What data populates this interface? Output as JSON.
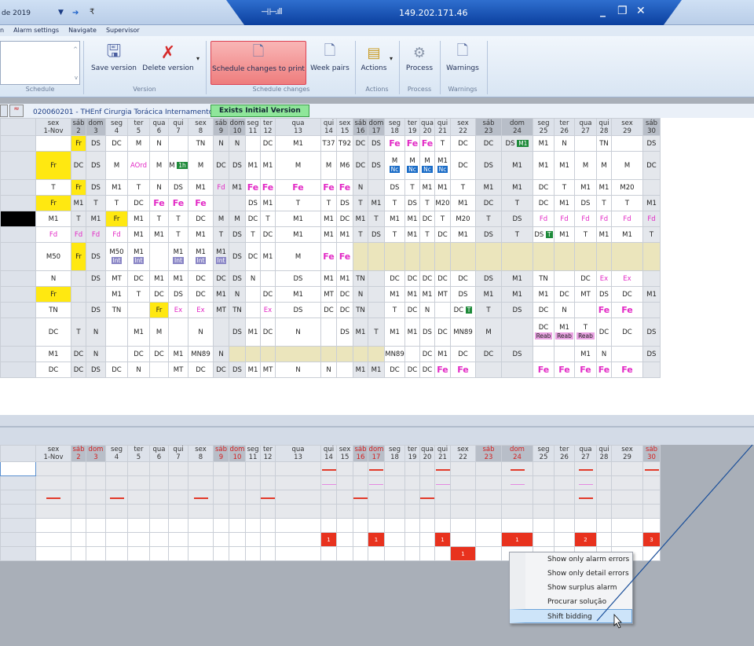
{
  "titlebar": {
    "date_text": "de 2019",
    "ip": "149.202.171.46"
  },
  "menu": [
    "n",
    "Alarm settings",
    "Navigate",
    "Supervisor"
  ],
  "ribbon": {
    "groups": {
      "schedule": "Schedule",
      "version": "Version",
      "schedule_changes": "Schedule changes",
      "actions": "Actions",
      "process": "Process",
      "warnings": "Warnings"
    },
    "buttons": {
      "save_version": "Save version",
      "delete_version": "Delete version",
      "schedule_changes_to_print": "Schedule changes to print",
      "week_pairs": "Week pairs",
      "actions": "Actions",
      "process": "Process",
      "warnings": "Warnings"
    }
  },
  "info": {
    "unit_code": "020060201 - THEnf Cirurgia Torácica Internamento",
    "version_badge": "Exists Initial Version"
  },
  "days": [
    {
      "dow": "sex",
      "d": "1-Nov",
      "we": false
    },
    {
      "dow": "sáb",
      "d": "2",
      "we": true
    },
    {
      "dow": "dom",
      "d": "3",
      "we": true
    },
    {
      "dow": "seg",
      "d": "4"
    },
    {
      "dow": "ter",
      "d": "5"
    },
    {
      "dow": "qua",
      "d": "6"
    },
    {
      "dow": "qui",
      "d": "7"
    },
    {
      "dow": "sex",
      "d": "8"
    },
    {
      "dow": "sáb",
      "d": "9",
      "we": true
    },
    {
      "dow": "dom",
      "d": "10",
      "we": true
    },
    {
      "dow": "seg",
      "d": "11"
    },
    {
      "dow": "ter",
      "d": "12"
    },
    {
      "dow": "qua",
      "d": "13"
    },
    {
      "dow": "qui",
      "d": "14"
    },
    {
      "dow": "sex",
      "d": "15"
    },
    {
      "dow": "sáb",
      "d": "16",
      "we": true
    },
    {
      "dow": "dom",
      "d": "17",
      "we": true
    },
    {
      "dow": "seg",
      "d": "18"
    },
    {
      "dow": "ter",
      "d": "19"
    },
    {
      "dow": "qua",
      "d": "20"
    },
    {
      "dow": "qui",
      "d": "21"
    },
    {
      "dow": "sex",
      "d": "22"
    },
    {
      "dow": "sáb",
      "d": "23",
      "we": true
    },
    {
      "dow": "dom",
      "d": "24",
      "we": true
    },
    {
      "dow": "seg",
      "d": "25"
    },
    {
      "dow": "ter",
      "d": "26"
    },
    {
      "dow": "qua",
      "d": "27"
    },
    {
      "dow": "qui",
      "d": "28"
    },
    {
      "dow": "sex",
      "d": "29"
    },
    {
      "dow": "sáb",
      "d": "30",
      "we": true
    }
  ],
  "rows": [
    [
      "",
      "Fr",
      "DS",
      "DC",
      "M",
      "N",
      "",
      "TN",
      "N",
      "N",
      "",
      "DC",
      "M1",
      "T37",
      "T92",
      "DC",
      "DS",
      "Fe",
      "Fe",
      "Fe",
      "T",
      "DC",
      "DC",
      "DS|M1",
      "M1",
      "N",
      "",
      "TN",
      "",
      "DS"
    ],
    [
      "Fr",
      "DC",
      "DS",
      "M",
      "AOrd",
      "M",
      "M|1h",
      "M",
      "DC",
      "DS",
      "M1",
      "M1",
      "M",
      "M",
      "M6",
      "DC",
      "DS",
      "M|Nc",
      "M|Nc",
      "M|Nc",
      "M1|Nc",
      "DC",
      "DS",
      "M1",
      "M1",
      "M1",
      "M",
      "M",
      "M",
      "DC"
    ],
    [
      "T",
      "Fr",
      "DS",
      "M1",
      "T",
      "N",
      "DS",
      "M1",
      "Fd",
      "M1",
      "Fe",
      "Fe",
      "Fe",
      "Fe",
      "Fe",
      "N",
      "",
      "DS",
      "T",
      "M1",
      "M1",
      "T",
      "M1",
      "M1",
      "DC",
      "T",
      "M1",
      "M1",
      "M20",
      ""
    ],
    [
      "Fr",
      "M1",
      "T",
      "T",
      "DC",
      "Fe",
      "Fe",
      "Fe",
      "",
      "",
      "DS",
      "M1",
      "T",
      "T",
      "DS",
      "T",
      "M1",
      "T",
      "DS",
      "T",
      "M20",
      "M1",
      "DC",
      "T",
      "DC",
      "M1",
      "DS",
      "T",
      "T",
      "M1"
    ],
    [
      "M1",
      "T",
      "M1",
      "Fr",
      "M1",
      "T",
      "T",
      "DC",
      "M",
      "M",
      "DC",
      "T",
      "M1",
      "M1",
      "DC",
      "M1",
      "T",
      "M1",
      "M1",
      "DC",
      "T",
      "M20",
      "T",
      "DS",
      "Fd",
      "Fd",
      "Fd",
      "Fd",
      "Fd",
      "Fd"
    ],
    [
      "Fd",
      "Fd",
      "Fd",
      "Fd",
      "M1",
      "M1",
      "T",
      "M1",
      "T",
      "DS",
      "T",
      "DC",
      "M1",
      "M1",
      "M1",
      "T",
      "DS",
      "T",
      "M1",
      "T",
      "DC",
      "M1",
      "DS",
      "T",
      "DS|T",
      "M1",
      "T",
      "M1",
      "M1",
      "T"
    ],
    [
      "M50",
      "Fr",
      "DS",
      "M50|Int",
      "M1|Int",
      "",
      "M1|Int",
      "M1|Int",
      "M1|Int",
      "DS",
      "DC",
      "M1",
      "M",
      "Fe",
      "Fe",
      "",
      "",
      "",
      "",
      "",
      "",
      "",
      "",
      "",
      "",
      "",
      "",
      "",
      "",
      ""
    ],
    [
      "N",
      "",
      "DS",
      "MT",
      "DC",
      "M1",
      "M1",
      "DC",
      "DC",
      "DS",
      "N",
      "",
      "DS",
      "M1",
      "M1",
      "TN",
      "",
      "DC",
      "DC",
      "DC",
      "DC",
      "DC",
      "DS",
      "M1",
      "TN",
      "",
      "DC",
      "Ex",
      "Ex",
      ""
    ],
    [
      "Fr",
      "",
      "",
      "M1",
      "T",
      "DC",
      "DS",
      "DC",
      "M1",
      "N",
      "",
      "DC",
      "M1",
      "MT",
      "DC",
      "N",
      "",
      "M1",
      "M1",
      "M1",
      "MT",
      "DS",
      "M1",
      "M1",
      "M1",
      "DC",
      "MT",
      "DS",
      "DC",
      "M1"
    ],
    [
      "TN",
      "",
      "DS",
      "TN",
      "",
      "Fr",
      "Ex",
      "Ex",
      "MT",
      "TN",
      "",
      "Ex",
      "DS",
      "DC",
      "DC",
      "TN",
      "",
      "T",
      "DC",
      "N",
      "",
      "DC|T",
      "T",
      "DS",
      "DC",
      "N",
      "",
      "Fe",
      "Fe",
      ""
    ],
    [
      "DC",
      "T",
      "N",
      "",
      "M1",
      "M",
      "",
      "N",
      "",
      "DS",
      "M1",
      "DC",
      "N",
      "",
      "DS",
      "M1",
      "T",
      "M1",
      "M1",
      "DS",
      "DC",
      "MN89",
      "M",
      "",
      "DC|Reab",
      "M1|Reab",
      "T|Reab",
      "DC",
      "DC",
      "DS"
    ],
    [
      "M1",
      "DC",
      "N",
      "",
      "DC",
      "DC",
      "M1",
      "MN89",
      "N",
      "",
      "",
      "",
      "",
      "",
      "",
      "",
      "",
      "MN89",
      "",
      "DC",
      "M1",
      "DC",
      "DC",
      "DS",
      "",
      "",
      "M1",
      "N",
      "",
      "DS"
    ],
    [
      "DC",
      "DC",
      "DS",
      "DC",
      "N",
      "",
      "MT",
      "DC",
      "DC",
      "DS",
      "M1",
      "MT",
      "N",
      "N",
      "",
      "M1",
      "M1",
      "DC",
      "DC",
      "DC",
      "Fe",
      "Fe",
      "",
      "",
      "Fe",
      "Fe",
      "Fe",
      "Fe",
      "Fe",
      ""
    ]
  ],
  "lower_counts": {
    "row5": {
      "14": "1",
      "17": "1",
      "21": "1",
      "24": "1",
      "27": "2",
      "30": "3"
    },
    "row6": {
      "22": "1"
    }
  },
  "context_menu": {
    "items": [
      "Show only alarm errors",
      "Show only detail errors",
      "Show surplus alarm",
      "Procurar solução",
      "Shift bidding"
    ],
    "active": "Shift bidding"
  }
}
